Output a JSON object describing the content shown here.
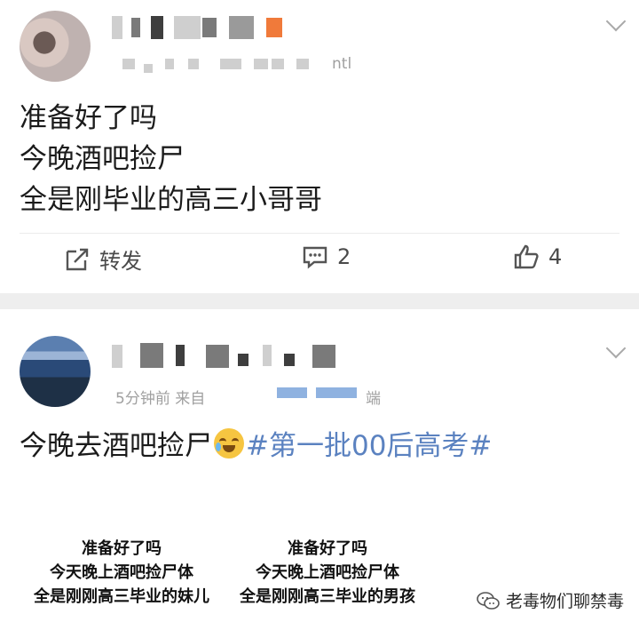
{
  "post1": {
    "meta_suffix": "ntl",
    "text_lines": [
      "准备好了吗",
      "今晚酒吧捡尸",
      "全是刚毕业的高三小哥哥"
    ],
    "actions": {
      "forward_label": "转发",
      "comment_count": "2",
      "like_count": "4"
    },
    "icons": {
      "forward": "share-icon",
      "comment": "comment-icon",
      "like": "thumbs-up-icon",
      "expand": "chevron-down-icon"
    }
  },
  "post2": {
    "meta_visible": "5分钟前  来自",
    "meta_tail": "端",
    "text": "今晚去酒吧捡尸",
    "emoji": "laughing-crying-emoji",
    "hashtag": "#第一批00后高考#",
    "meme": {
      "left_lines": [
        "准备好了吗",
        "今天晚上酒吧捡尸体",
        "全是刚刚高三毕业的妹儿"
      ],
      "right_lines": [
        "准备好了吗",
        "今天晚上酒吧捡尸体",
        "全是刚刚高三毕业的男孩"
      ]
    },
    "colors": {
      "hashtag": "#5b82c0",
      "text": "#1b1b1b",
      "meta": "#a0a0a0"
    }
  },
  "watermark": {
    "text": "老毒物们聊禁毒",
    "icon": "wechat-icon"
  }
}
